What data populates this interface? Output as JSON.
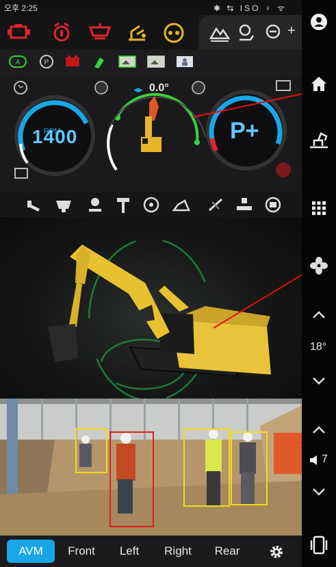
{
  "status_bar": {
    "time": "오후 2:25",
    "system_icons": "✱ ⇆ ISO ♀ ᯤ"
  },
  "gauges": {
    "rpm_label": "RPM",
    "rpm_value": "1400",
    "angle_value": "0.0°",
    "mode_value": "P+"
  },
  "rail": {
    "slope_value": "18°",
    "volume_value": "7"
  },
  "tabs": [
    "AVM",
    "Front",
    "Left",
    "Right",
    "Rear"
  ],
  "active_tab": "AVM",
  "colors": {
    "accent": "#19a6e6",
    "warning_red": "#e0252b",
    "warning_yellow": "#e7b52a",
    "gauge_green": "#3ad13a",
    "detection_red": "#e21c1c",
    "detection_yellow": "#f3dd17"
  },
  "icons": {
    "warning_icons": [
      "engine-warning-icon",
      "coolant-warning-icon",
      "oil-warning-icon",
      "hydraulic-warning-icon",
      "filter-warning-icon"
    ],
    "status_icons": [
      "auto-mode-icon",
      "parking-icon",
      "battery-icon",
      "work-light-icon",
      "camera-front-icon",
      "camera-rear-icon",
      "seatbelt-icon"
    ],
    "bottom_icons": [
      "tool-icon",
      "bucket-icon",
      "boom-icon",
      "hammer-icon",
      "fan-icon",
      "travel-icon",
      "wiper-icon",
      "quickcoupler-icon",
      "seat-icon"
    ]
  }
}
